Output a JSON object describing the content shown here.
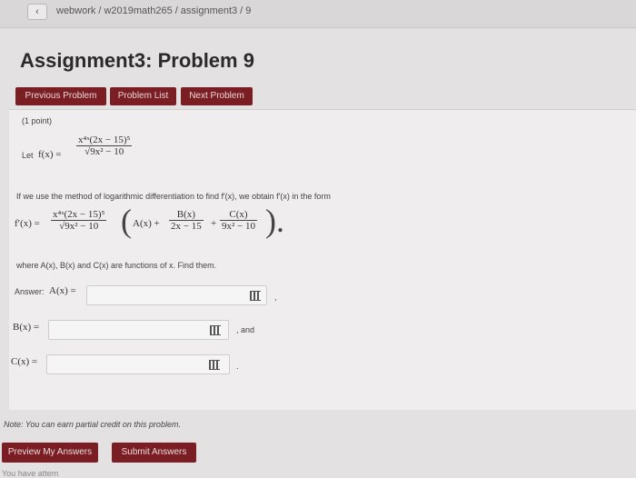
{
  "breadcrumb": [
    "webwork",
    "/",
    "w2019math265",
    "/",
    "assignment3",
    "/",
    "9"
  ],
  "back_icon": "‹",
  "title": "Assignment3: Problem 9",
  "nav": {
    "previous": "Previous Problem",
    "list": "Problem List",
    "next": "Next Problem"
  },
  "problem": {
    "points": "(1 point)",
    "let_label": "Let",
    "fx_label": "f(x) =",
    "f_num": "x⁴ˣ(2x − 15)⁵",
    "f_den": "√9x² − 10",
    "instruction": "If we use the method of logarithmic differentiation to find f′(x), we obtain f′(x) in the form",
    "fprime_label": "f′(x) =",
    "form_num": "x⁴ˣ(2x − 15)⁵",
    "form_den": "√9x² − 10",
    "A_term": "A(x) +",
    "B_num": "B(x)",
    "B_den": "2x − 15",
    "plus": "+",
    "C_num": "C(x)",
    "C_den": "9x² − 10",
    "where_text": "where A(x), B(x) and C(x) are functions of x. Find them."
  },
  "answers": {
    "answer_label": "Answer:",
    "A_label": "A(x) =",
    "B_label": "B(x) =",
    "C_label": "C(x) =",
    "comma": ",",
    "and_text": ", and",
    "period": "."
  },
  "note": "Note: You can earn partial credit on this problem.",
  "actions": {
    "preview": "Preview My Answers",
    "submit": "Submit Answers"
  },
  "footer_partial": "You have attem"
}
